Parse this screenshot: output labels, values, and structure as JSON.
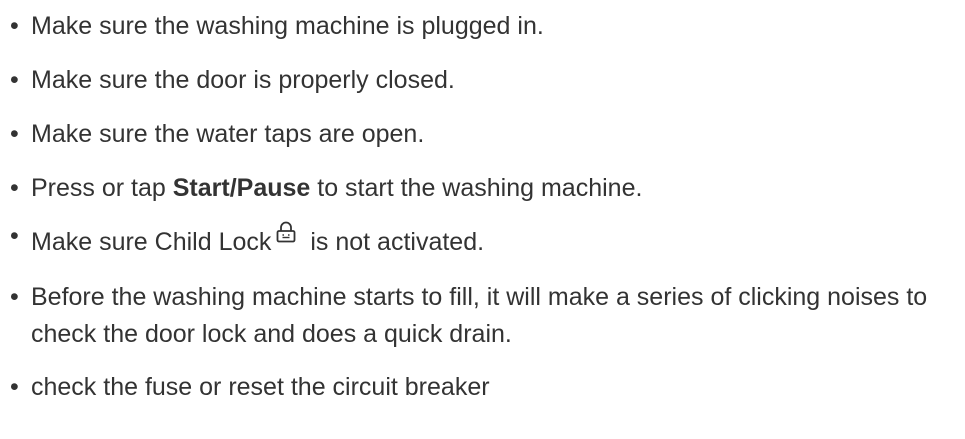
{
  "items": [
    {
      "text": "Make sure the washing machine is plugged in."
    },
    {
      "text": "Make sure the door is properly closed."
    },
    {
      "text": "Make sure the water taps are open."
    },
    {
      "before": "Press or tap ",
      "bold": "Start/Pause",
      "after": " to start the washing machine."
    },
    {
      "before": "Make sure Child Lock",
      "icon": "lock-icon",
      "after": " is not activated."
    },
    {
      "text": "Before the washing machine starts to fill, it will make a series of clicking noises to check the door lock and does a quick drain."
    },
    {
      "text": "check the fuse or reset the circuit breaker"
    }
  ]
}
